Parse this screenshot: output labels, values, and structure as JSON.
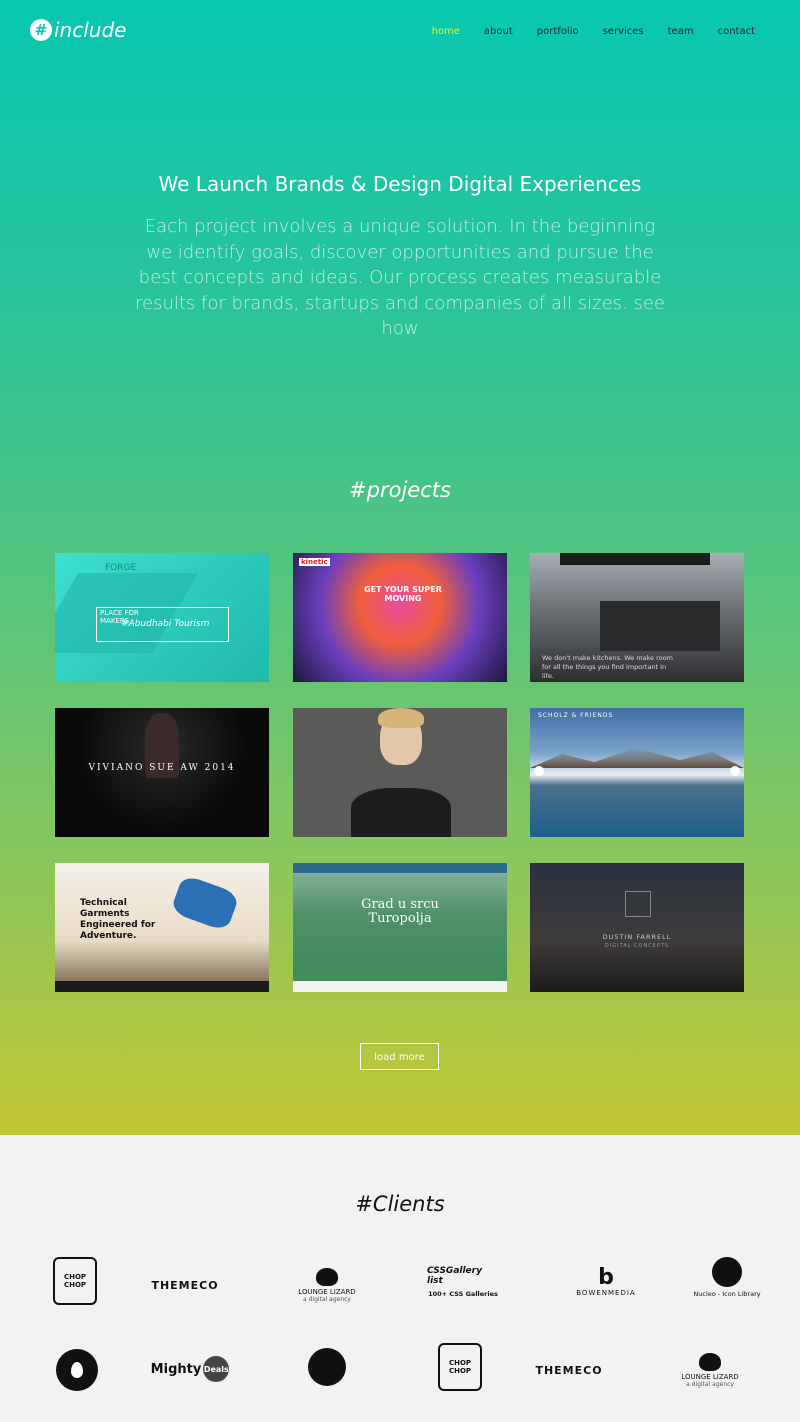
{
  "brand": {
    "name": "include",
    "mark": "#"
  },
  "nav": [
    {
      "label": "home",
      "active": true
    },
    {
      "label": "about"
    },
    {
      "label": "portfolio"
    },
    {
      "label": "services"
    },
    {
      "label": "team"
    },
    {
      "label": "contact"
    }
  ],
  "hero": {
    "headline": "We Launch Brands & Design Digital Experiences",
    "intro": "Each project involves a unique solution. In the beginning we identify goals, discover opportunities and pursue the best concepts and ideas. Our process creates measurable results for brands, startups and companies of all sizes. see how"
  },
  "projects": {
    "title": "#projects",
    "items": [
      {
        "caption": "#Abudhabi Tourism",
        "sub": "PLACE FOR MAKERS",
        "top": "FORGE"
      },
      {
        "caption": "GET YOUR SUPER MOVING",
        "top": "kinetic"
      },
      {
        "caption": "We don't make kitchens. We make room for all the things you find important in life."
      },
      {
        "caption": "VIVIANO SUE AW 2014"
      },
      {
        "caption": ""
      },
      {
        "caption": "SCHOLZ & FRIENDS"
      },
      {
        "caption": "Technical Garments Engineered for Adventure."
      },
      {
        "caption": "Grad u srcu Turopolja"
      },
      {
        "caption": "DUSTIN FARRELL",
        "sub": "DIGITAL CONCEPTS"
      }
    ],
    "load_more": "load more"
  },
  "clients": {
    "title": "#Clients",
    "row1": [
      {
        "name": "CHOP CHOP"
      },
      {
        "name": "THEMECO"
      },
      {
        "name": "LOUNGE LIZARD",
        "sub": "a digital agency"
      },
      {
        "name": "CSSGallery list",
        "sub": "100+ CSS Galleries"
      },
      {
        "name": "BOWENMEDIA"
      },
      {
        "name": "Nucleo - Icon Library"
      }
    ],
    "row2": [
      {
        "name": ""
      },
      {
        "name": "Mighty",
        "sub": "Deals"
      },
      {
        "name": ""
      },
      {
        "name": "CHOP CHOP"
      },
      {
        "name": "THEMECO"
      },
      {
        "name": "LOUNGE LIZARD",
        "sub": "a digital agency"
      }
    ]
  },
  "colors": {
    "accent": "#e6f42a",
    "teal": "#07c7b0",
    "lime": "#c2c734"
  }
}
